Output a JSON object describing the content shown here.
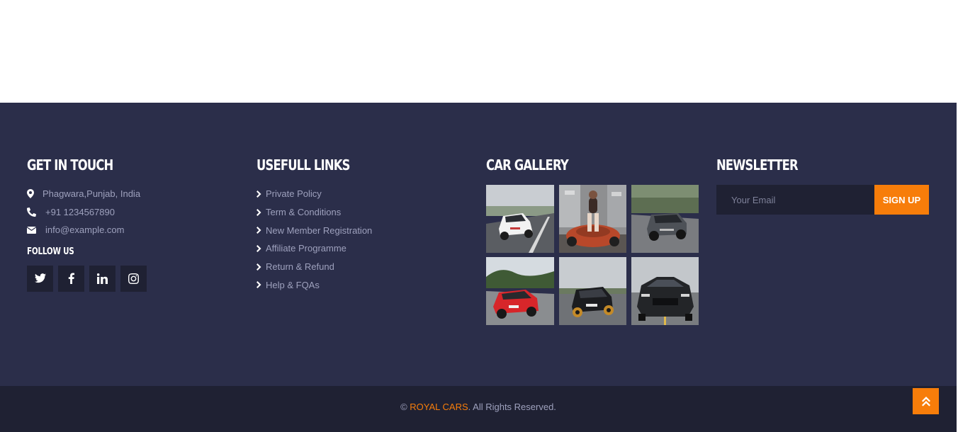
{
  "contact": {
    "title": "GET IN TOUCH",
    "address": "Phagwara,Punjab, India",
    "phone": "+91 1234567890",
    "email": "info@example.com",
    "follow_title": "FOLLOW US",
    "socials": [
      "twitter-icon",
      "facebook-icon",
      "linkedin-icon",
      "instagram-icon"
    ]
  },
  "links": {
    "title": "USEFULL LINKS",
    "items": [
      {
        "label": "Private Policy"
      },
      {
        "label": "Term & Conditions"
      },
      {
        "label": "New Member Registration"
      },
      {
        "label": "Affiliate Programme"
      },
      {
        "label": "Return & Refund"
      },
      {
        "label": "Help & FQAs"
      }
    ]
  },
  "gallery": {
    "title": "CAR GALLERY",
    "images": [
      "white-hatchback-road",
      "woman-on-red-sports-car",
      "grey-suv-road",
      "red-hatchback-road",
      "black-hatchback-road",
      "black-mustang-front"
    ]
  },
  "newsletter": {
    "title": "NEWSLETTER",
    "placeholder": "Your Email",
    "button": "SIGN UP"
  },
  "copyright": {
    "symbol": "©",
    "brand": "ROYAL CARS",
    "rest": ". All Rights Reserved."
  },
  "colors": {
    "footer_bg": "#2b2e4a",
    "bottom_bg": "#1f2133",
    "accent": "#f77d0a",
    "muted_text": "#9ea1bd"
  }
}
